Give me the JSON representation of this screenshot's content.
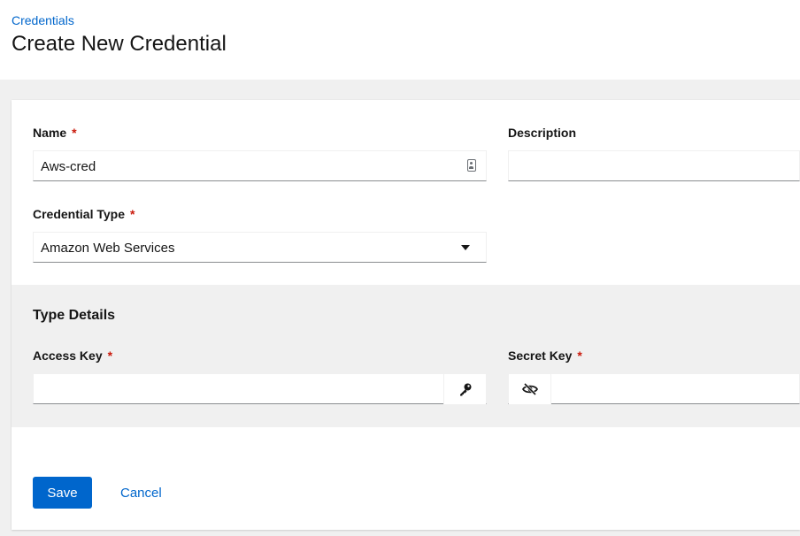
{
  "breadcrumb": {
    "label": "Credentials"
  },
  "page": {
    "title": "Create New Credential"
  },
  "form": {
    "name": {
      "label": "Name",
      "required_mark": "*",
      "value": "Aws-cred"
    },
    "description": {
      "label": "Description",
      "value": ""
    },
    "credential_type": {
      "label": "Credential Type",
      "required_mark": "*",
      "selected": "Amazon Web Services"
    },
    "type_details": {
      "title": "Type Details",
      "access_key": {
        "label": "Access Key",
        "required_mark": "*",
        "value": ""
      },
      "secret_key": {
        "label": "Secret Key",
        "required_mark": "*",
        "value": ""
      }
    },
    "actions": {
      "save": "Save",
      "cancel": "Cancel"
    }
  },
  "icons": {
    "name_field": "id-card-icon",
    "credential_type": "caret-down-icon",
    "access_key": "key-icon",
    "secret_key": "eye-slash-icon"
  },
  "colors": {
    "primary": "#0066cc",
    "required": "#c9190b",
    "background": "#f0f0f0"
  }
}
